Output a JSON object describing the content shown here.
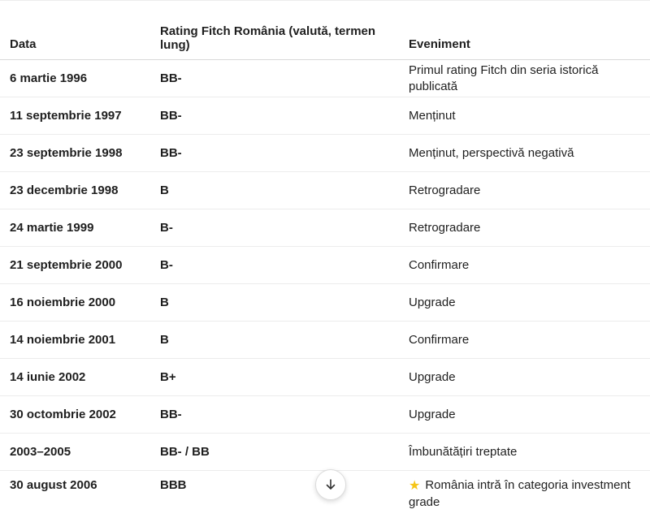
{
  "table": {
    "headers": [
      "Data",
      "Rating Fitch România (valută, termen lung)",
      "Eveniment"
    ],
    "rows": [
      {
        "date": "6 martie 1996",
        "rating": "BB-",
        "event": "Primul rating Fitch din seria istorică publicată"
      },
      {
        "date": "11 septembrie 1997",
        "rating": "BB-",
        "event": "Menținut"
      },
      {
        "date": "23 septembrie 1998",
        "rating": "BB-",
        "event": "Menținut, perspectivă negativă"
      },
      {
        "date": "23 decembrie 1998",
        "rating": "B",
        "event": "Retrogradare"
      },
      {
        "date": "24 martie 1999",
        "rating": "B-",
        "event": "Retrogradare"
      },
      {
        "date": "21 septembrie 2000",
        "rating": "B-",
        "event": "Confirmare"
      },
      {
        "date": "16 noiembrie 2000",
        "rating": "B",
        "event": "Upgrade"
      },
      {
        "date": "14 noiembrie 2001",
        "rating": "B",
        "event": "Confirmare"
      },
      {
        "date": "14 iunie 2002",
        "rating": "B+",
        "event": "Upgrade"
      },
      {
        "date": "30 octombrie 2002",
        "rating": "BB-",
        "event": "Upgrade"
      },
      {
        "date": "2003–2005",
        "rating": "BB- / BB",
        "event": "Îmbunătățiri treptate"
      },
      {
        "date": "30 august 2006",
        "rating": "BBB",
        "event": "România intră în categoria investment grade",
        "icon": "star-icon"
      }
    ]
  },
  "scroll_button": {
    "icon": "arrow-down-icon"
  }
}
